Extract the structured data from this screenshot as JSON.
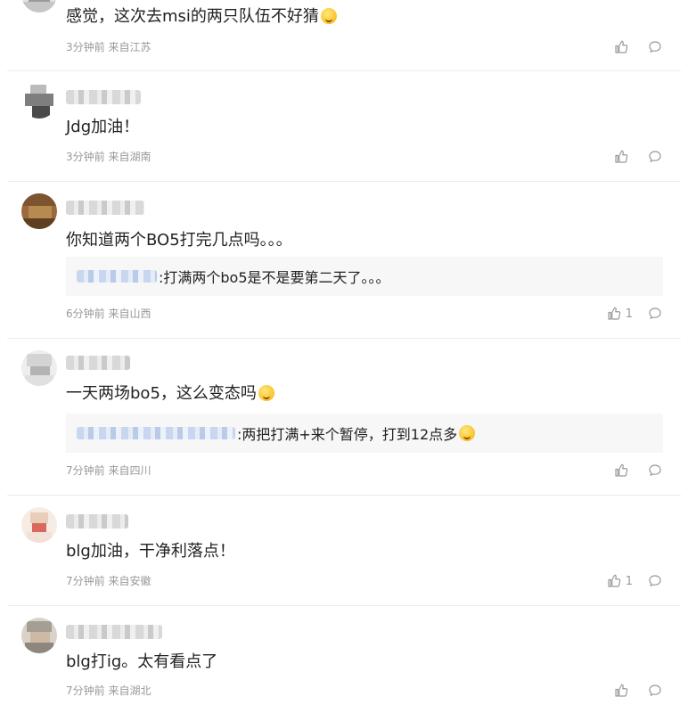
{
  "comments": [
    {
      "text": "感觉，这次去msi的两只队伍不好猜",
      "emoji": "squint-face",
      "meta": "3分钟前 来自江苏",
      "likes": ""
    },
    {
      "text": "Jdg加油！",
      "meta": "3分钟前 来自湖南",
      "likes": ""
    },
    {
      "text": "你知道两个BO5打完几点吗。。。",
      "reply": ":打满两个bo5是不是要第二天了。。。",
      "meta": "6分钟前 来自山西",
      "likes": "1"
    },
    {
      "text": "一天两场bo5，这么变态吗",
      "emoji": "laughing-tears-face",
      "reply": ":两把打满+来个暂停，打到12点多",
      "meta": "7分钟前 来自四川",
      "likes": ""
    },
    {
      "text": "blg加油，干净利落点！",
      "meta": "7分钟前 来自安徽",
      "likes": "1"
    },
    {
      "text": "blg打ig。太有看点了",
      "meta": "7分钟前 来自湖北",
      "likes": ""
    }
  ],
  "icons": {
    "like": "thumbs-up-icon",
    "reply": "comment-bubble-icon"
  },
  "colors": {
    "text": "#222222",
    "meta": "#999999",
    "reply_bg": "#f7f7f7",
    "divider": "#ececec"
  }
}
